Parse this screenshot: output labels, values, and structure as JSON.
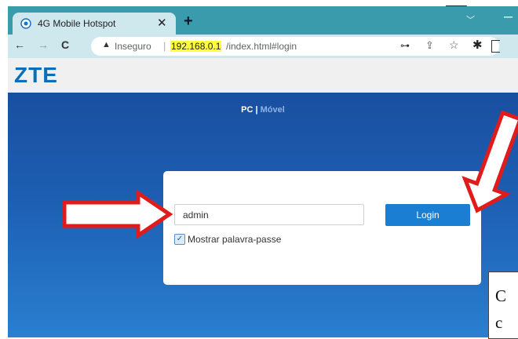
{
  "document": {
    "top_link_text": "____"
  },
  "browser": {
    "tab": {
      "title": "4G Mobile Hotspot",
      "favicon": "globe-icon"
    },
    "new_tab_label": "+",
    "omnibox": {
      "security_label": "Inseguro",
      "url_host": "192.168.0.1",
      "url_path": "/index.html#login",
      "host_highlight_color": "#ffff3a"
    },
    "accent_color": "#3a9bad"
  },
  "page": {
    "logo": "ZTE",
    "logo_color": "#0a6fb8",
    "switcher": {
      "pc": "PC",
      "separator": "|",
      "mobile": "Móvel"
    },
    "login": {
      "field_value": "admin",
      "button_label": "Login",
      "show_password_label": "Mostrar palavra-passe",
      "show_password_checked": true
    },
    "button_color": "#1a7fd2"
  },
  "annotation": {
    "arrow_color": "#e01b1b",
    "caption_lines": [
      "C",
      "c"
    ]
  }
}
